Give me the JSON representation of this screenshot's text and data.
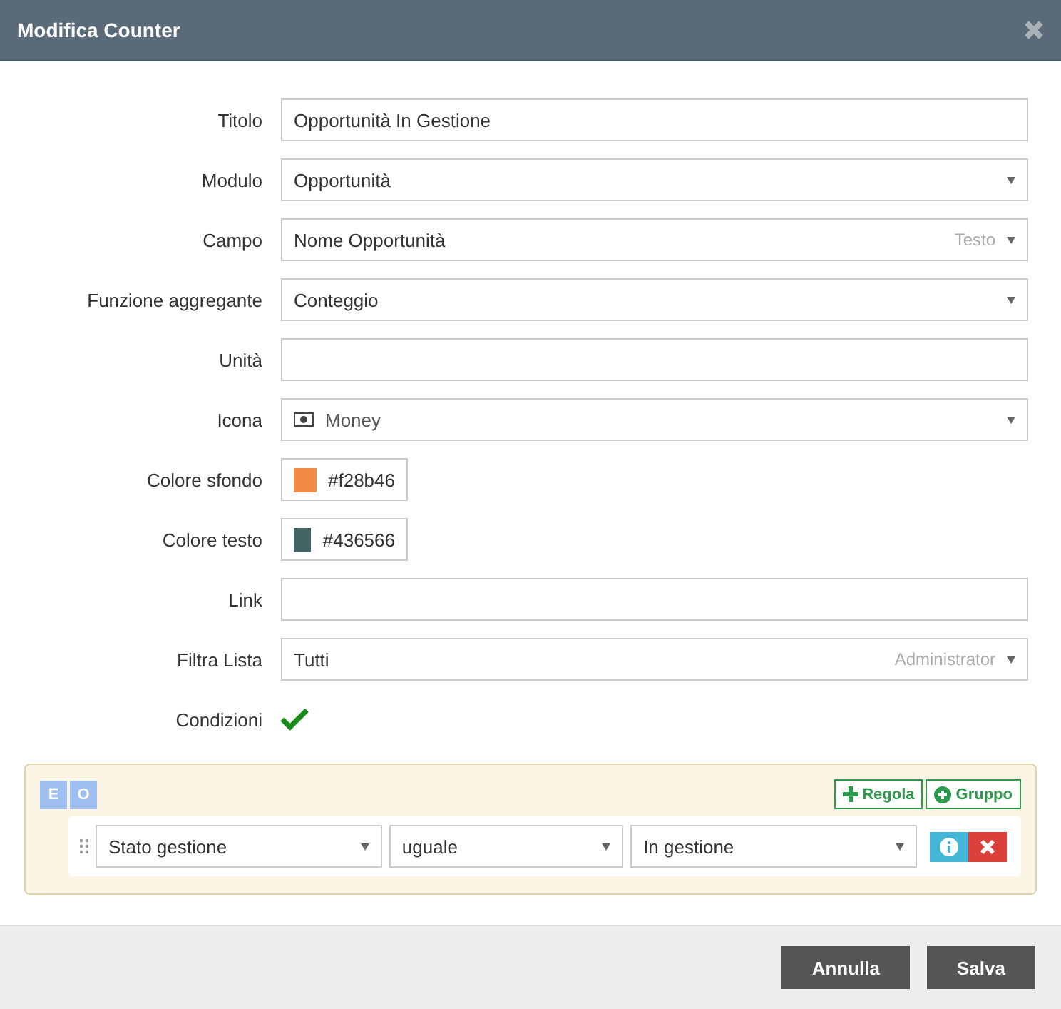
{
  "window": {
    "title": "Modifica Counter"
  },
  "fields": [
    {
      "label": "Titolo",
      "kind": "text",
      "value": "Opportunità In Gestione"
    },
    {
      "label": "Modulo",
      "kind": "select",
      "value": "Opportunità"
    },
    {
      "label": "Campo",
      "kind": "select",
      "value": "Nome Opportunità",
      "hint": "Testo"
    },
    {
      "label": "Funzione aggregante",
      "kind": "select",
      "value": "Conteggio"
    },
    {
      "label": "Unità",
      "kind": "text"
    },
    {
      "label": "Icona",
      "kind": "select",
      "value": "Money",
      "has_icon": true
    },
    {
      "label": "Colore sfondo",
      "kind": "color",
      "value": "#f28b46",
      "color": "#f28b46"
    },
    {
      "label": "Colore testo",
      "kind": "color",
      "value": "#436566",
      "color": "#436566"
    },
    {
      "label": "Link",
      "kind": "text"
    },
    {
      "label": "Filtra Lista",
      "kind": "select",
      "value": "Tutti",
      "hint": "Administrator"
    },
    {
      "label": "Condizioni",
      "kind": "checkbox",
      "checked": true
    }
  ],
  "conditions": {
    "logic": [
      "E",
      "O"
    ],
    "add_rule": "Regola",
    "add_group": "Gruppo",
    "rules": [
      {
        "field": "Stato gestione",
        "operator": "uguale",
        "value": "In gestione"
      }
    ]
  },
  "footer": {
    "buttons": [
      "Annulla",
      "Salva"
    ]
  }
}
